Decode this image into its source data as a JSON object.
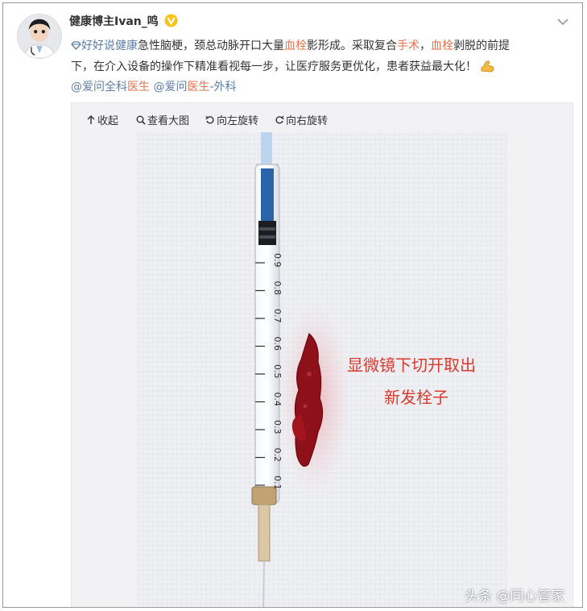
{
  "post": {
    "username": "健康博主Ivan_鸣",
    "verified_icon": "verified-v-badge-icon",
    "text": {
      "topic": "好好说健康",
      "p1": "急性脑梗，颈总动脉开口大量",
      "hl1": "血栓",
      "p2": "影形成。采取复合",
      "hl2": "手术",
      "p3": "，",
      "hl3": "血栓",
      "p4": "剥脱的前提",
      "line2": "下，在介入设备的操作下精准看视每一步，让医疗服务更优化，患者获益最大化！"
    },
    "mentions": {
      "m1_prefix": "@爱问全科",
      "m1_hl": "医生",
      "m2_prefix": "@爱问",
      "m2_hl": "医生",
      "m2_suffix": "-外科"
    }
  },
  "toolbar": {
    "collapse": "收起",
    "view_large": "查看大图",
    "rotate_left": "向左旋转",
    "rotate_right": "向右旋转"
  },
  "photo": {
    "caption_line1": "显微镜下切开取出",
    "caption_line2": "新发栓子",
    "syringe_scale": [
      "0.9",
      "0.8",
      "0.7",
      "0.6",
      "0.5",
      "0.4",
      "0.3",
      "0.2",
      "0.1"
    ]
  },
  "watermark": "头条 @同心管家",
  "colors": {
    "highlight": "#eb7350",
    "link": "#5d7ea9",
    "caption": "#d83a2e"
  }
}
